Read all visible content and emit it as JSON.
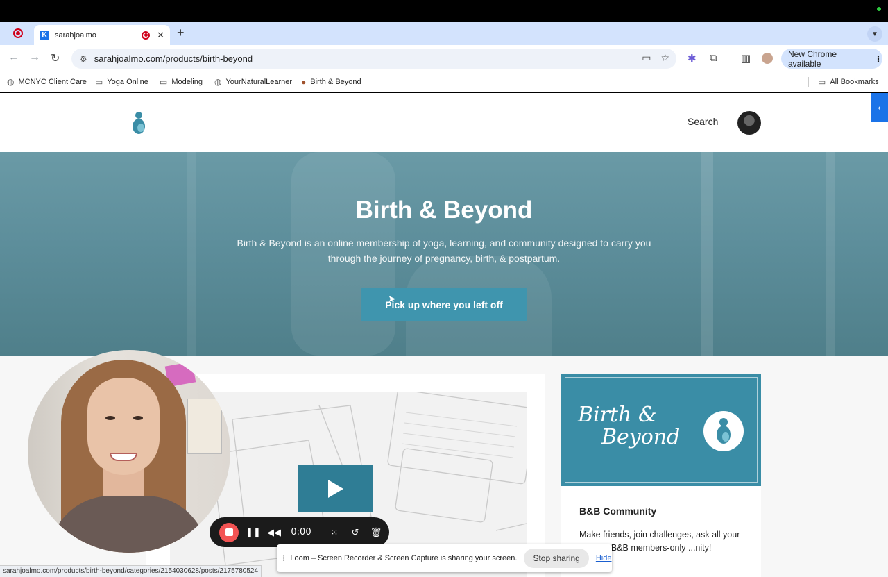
{
  "browser": {
    "tab": {
      "title": "sarahjoalmo",
      "favicon": "K"
    },
    "new_tab_glyph": "+",
    "address": "sarahjoalmo.com/products/birth-beyond",
    "new_chrome_label": "New Chrome available",
    "bookmarks": [
      {
        "label": "MCNYC Client Care",
        "icon": "globe-icon"
      },
      {
        "label": "Yoga Online",
        "icon": "folder-icon"
      },
      {
        "label": "Modeling",
        "icon": "folder-icon"
      },
      {
        "label": "YourNaturalLearner",
        "icon": "globe-icon"
      },
      {
        "label": "Birth & Beyond",
        "icon": "site-icon"
      }
    ],
    "all_bookmarks_label": "All Bookmarks",
    "status_url": "sarahjoalmo.com/products/birth-beyond/categories/2154030628/posts/2175780524"
  },
  "site": {
    "search_label": "Search",
    "hero": {
      "title": "Birth & Beyond",
      "subtitle": "Birth & Beyond is an online membership of yoga, learning, and community designed to carry you through the journey of pregnancy, birth, & postpartum.",
      "cta": "Pick up where you left off"
    },
    "side_card": {
      "banner_line1": "Birth &",
      "banner_line2": "Beyond",
      "title": "B&B Community",
      "text": "Make friends, join challenges, ask all your ... e our B&B members-only ...nity!"
    }
  },
  "loom": {
    "time": "0:00",
    "share_message": "Loom – Screen Recorder & Screen Capture is sharing your screen.",
    "stop_sharing": "Stop sharing",
    "hide": "Hide"
  },
  "colors": {
    "accent": "#3f95ae",
    "banner": "#3a8da6",
    "tabstrip": "#d3e3fd",
    "loom_stop": "#f35353"
  }
}
